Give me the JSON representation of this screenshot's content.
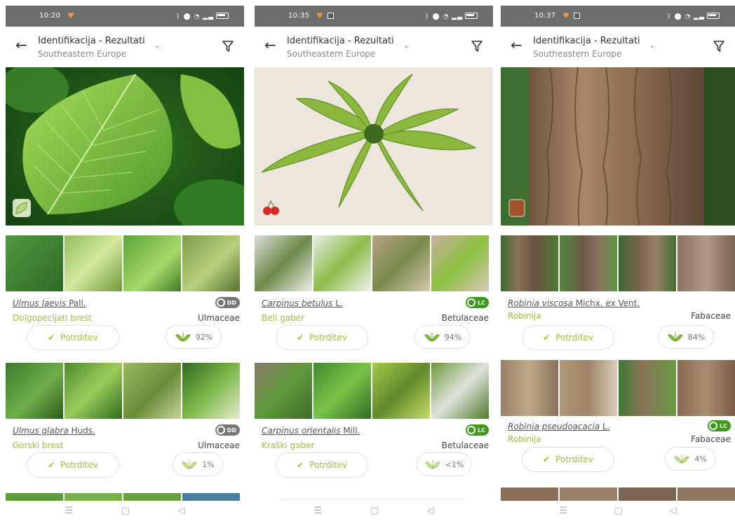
{
  "colors": {
    "accent_green": "#9cc238",
    "status_bar": "#6d6d6d",
    "lc_badge": "#3a9b1c",
    "dd_badge": "#777777"
  },
  "screens": [
    {
      "time": "10:20",
      "title": "Identifikacija - Rezultati",
      "region": "Southeastern Europe",
      "results": [
        {
          "scientific": "Ulmus laevis",
          "author": "Pall.",
          "common": "Dolgopecljati brest",
          "family": "Ulmaceae",
          "status": "DD",
          "confirm": "Potrditev",
          "score": "92%"
        },
        {
          "scientific": "Ulmus glabra",
          "author": "Huds.",
          "common": "Gorski brest",
          "family": "Ulmaceae",
          "status": "DD",
          "confirm": "Potrditev",
          "score": "1%"
        }
      ]
    },
    {
      "time": "10:35",
      "title": "Identifikacija - Rezultati",
      "region": "Southeastern Europe",
      "results": [
        {
          "scientific": "Carpinus betulus",
          "author": "L.",
          "common": "Beli gaber",
          "family": "Betulaceae",
          "status": "LC",
          "confirm": "Potrditev",
          "score": "94%"
        },
        {
          "scientific": "Carpinus orientalis",
          "author": "Mill.",
          "common": "Kraški gaber",
          "family": "Betulaceae",
          "status": "LC",
          "confirm": "Potrditev",
          "score": "<1%"
        }
      ]
    },
    {
      "time": "10:37",
      "title": "Identifikacija - Rezultati",
      "region": "Southeastern Europe",
      "results": [
        {
          "scientific": "Robinia viscosa",
          "author": "Michx. ex Vent.",
          "common": "Robinija",
          "family": "Fabaceae",
          "status": "",
          "confirm": "Potrditev",
          "score": "84%"
        },
        {
          "scientific": "Robinia pseudoacacia",
          "author": "L.",
          "common": "Robinija",
          "family": "Fabaceae",
          "status": "LC",
          "confirm": "Potrditev",
          "score": "4%"
        }
      ]
    }
  ]
}
